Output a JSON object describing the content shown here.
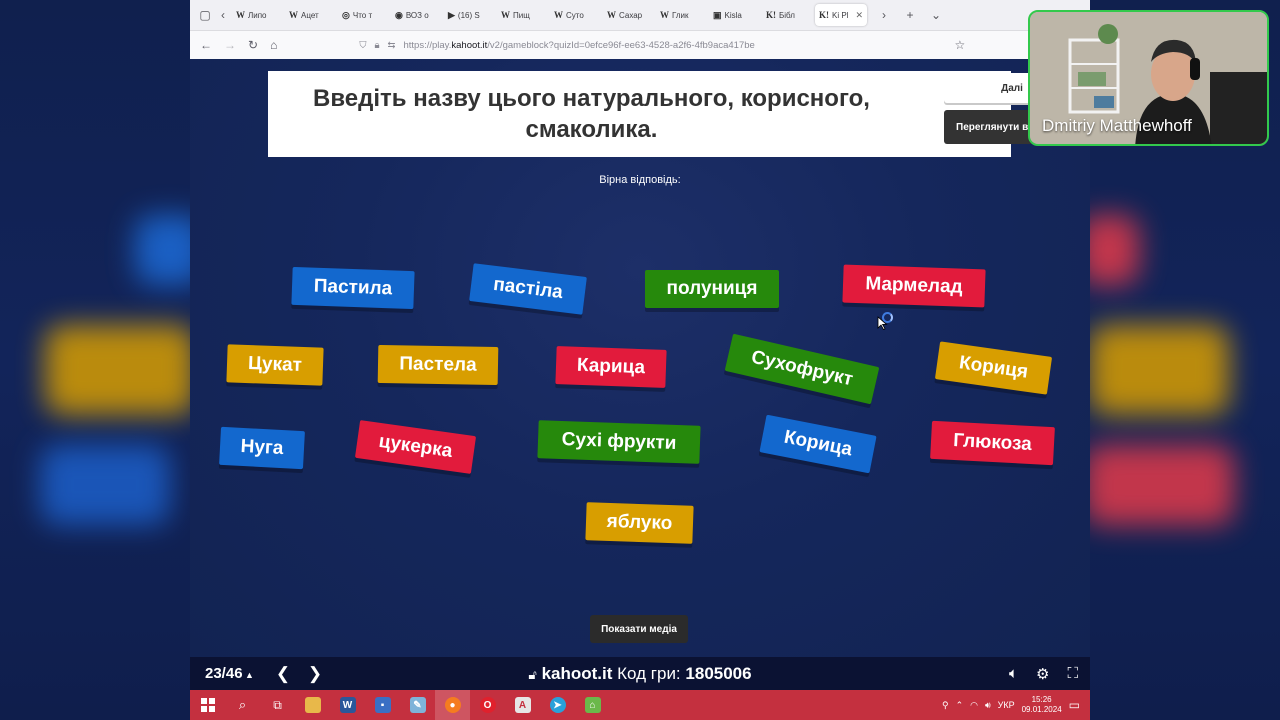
{
  "browser": {
    "tabs": [
      {
        "icon": "W",
        "label": "Липо"
      },
      {
        "icon": "W",
        "label": "Ацет"
      },
      {
        "icon": "◎",
        "label": "Что т"
      },
      {
        "icon": "◉",
        "label": "ВОЗ о"
      },
      {
        "icon": "▶",
        "label": "(16) S"
      },
      {
        "icon": "W",
        "label": "Пищ"
      },
      {
        "icon": "W",
        "label": "Суто"
      },
      {
        "icon": "W",
        "label": "Сахар"
      },
      {
        "icon": "W",
        "label": "Глик"
      },
      {
        "icon": "▣",
        "label": "Kisla"
      },
      {
        "icon": "K!",
        "label": "Бібл"
      },
      {
        "icon": "K!",
        "label": "Ki Pl"
      }
    ],
    "url_prefix": "https://play.",
    "url_host": "kahoot.it",
    "url_path": "/v2/gameblock?quizId=0efce96f-ee63-4528-a2f6-4fb9aca417be"
  },
  "game": {
    "question": "Введіть назву цього натурального, корисного, смаколика.",
    "next_label": "Далі",
    "review_label": "Переглянути в",
    "correct_label": "Вірна відповідь:",
    "show_media_label": "Показати медіа",
    "answers": [
      {
        "text": "Пастила",
        "color": "#1368ce"
      },
      {
        "text": "пастіла",
        "color": "#1368ce"
      },
      {
        "text": "полуниця",
        "color": "#26890c"
      },
      {
        "text": "Мармелад",
        "color": "#e21b3c"
      },
      {
        "text": "Цукат",
        "color": "#d89e00"
      },
      {
        "text": "Пастела",
        "color": "#d89e00"
      },
      {
        "text": "Карица",
        "color": "#e21b3c"
      },
      {
        "text": "Сухофрукт",
        "color": "#26890c"
      },
      {
        "text": "Кориця",
        "color": "#d89e00"
      },
      {
        "text": "Нуга",
        "color": "#1368ce"
      },
      {
        "text": "цукерка",
        "color": "#e21b3c"
      },
      {
        "text": "Сухі фрукти",
        "color": "#26890c"
      },
      {
        "text": "Корица",
        "color": "#1368ce"
      },
      {
        "text": "Глюкоза",
        "color": "#e21b3c"
      },
      {
        "text": "яблуко",
        "color": "#d89e00"
      }
    ]
  },
  "presenter_bar": {
    "counter": "23/46",
    "site": "kahoot.it",
    "pin_label": "Код гри:",
    "pin": "1805006"
  },
  "taskbar": {
    "lang": "УКР",
    "time": "15:26",
    "date": "09.01.2024"
  },
  "webcam": {
    "name": "Dmitriy Matthewhoff"
  }
}
